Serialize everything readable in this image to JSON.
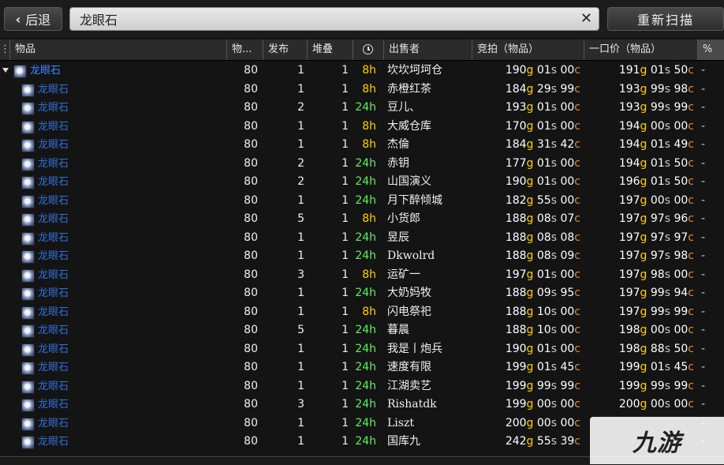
{
  "toolbar": {
    "back_label": "后退",
    "search_value": "龙眼石",
    "rescan_label": "重新扫描"
  },
  "columns": [
    "物品",
    "物...",
    "发布",
    "堆叠",
    "出售者",
    "竞拍（物品）",
    "一口价（物品）",
    "%"
  ],
  "parent": {
    "name": "龙眼石",
    "level": "80",
    "posts": "1",
    "stack": "1",
    "time": "8h",
    "seller": "坎坎坷坷仓",
    "bid": [
      "190",
      "01",
      "00"
    ],
    "buyout": [
      "191",
      "01",
      "50"
    ]
  },
  "rows": [
    {
      "name": "龙眼石",
      "level": "80",
      "posts": "1",
      "stack": "1",
      "time": "8h",
      "seller": "赤橙红茶",
      "bid": [
        "184",
        "29",
        "99"
      ],
      "buyout": [
        "193",
        "99",
        "98"
      ]
    },
    {
      "name": "龙眼石",
      "level": "80",
      "posts": "2",
      "stack": "1",
      "time": "24h",
      "seller": "豆儿、",
      "bid": [
        "193",
        "01",
        "00"
      ],
      "buyout": [
        "193",
        "99",
        "99"
      ]
    },
    {
      "name": "龙眼石",
      "level": "80",
      "posts": "1",
      "stack": "1",
      "time": "8h",
      "seller": "大威仓库",
      "bid": [
        "170",
        "01",
        "00"
      ],
      "buyout": [
        "194",
        "00",
        "00"
      ]
    },
    {
      "name": "龙眼石",
      "level": "80",
      "posts": "1",
      "stack": "1",
      "time": "8h",
      "seller": "杰倫",
      "bid": [
        "184",
        "31",
        "42"
      ],
      "buyout": [
        "194",
        "01",
        "49"
      ]
    },
    {
      "name": "龙眼石",
      "level": "80",
      "posts": "2",
      "stack": "1",
      "time": "24h",
      "seller": "赤钥",
      "bid": [
        "177",
        "01",
        "00"
      ],
      "buyout": [
        "194",
        "01",
        "50"
      ]
    },
    {
      "name": "龙眼石",
      "level": "80",
      "posts": "2",
      "stack": "1",
      "time": "24h",
      "seller": "山国演义",
      "bid": [
        "190",
        "01",
        "00"
      ],
      "buyout": [
        "196",
        "01",
        "50"
      ]
    },
    {
      "name": "龙眼石",
      "level": "80",
      "posts": "1",
      "stack": "1",
      "time": "24h",
      "seller": "月下醉倾城",
      "bid": [
        "182",
        "55",
        "00"
      ],
      "buyout": [
        "197",
        "00",
        "00"
      ]
    },
    {
      "name": "龙眼石",
      "level": "80",
      "posts": "5",
      "stack": "1",
      "time": "8h",
      "seller": "小货郎",
      "bid": [
        "188",
        "08",
        "07"
      ],
      "buyout": [
        "197",
        "97",
        "96"
      ]
    },
    {
      "name": "龙眼石",
      "level": "80",
      "posts": "1",
      "stack": "1",
      "time": "24h",
      "seller": "昱辰",
      "bid": [
        "188",
        "08",
        "08"
      ],
      "buyout": [
        "197",
        "97",
        "97"
      ]
    },
    {
      "name": "龙眼石",
      "level": "80",
      "posts": "1",
      "stack": "1",
      "time": "24h",
      "seller": "Dkwolrd",
      "bid": [
        "188",
        "08",
        "09"
      ],
      "buyout": [
        "197",
        "97",
        "98"
      ]
    },
    {
      "name": "龙眼石",
      "level": "80",
      "posts": "3",
      "stack": "1",
      "time": "8h",
      "seller": "运矿一",
      "bid": [
        "197",
        "01",
        "00"
      ],
      "buyout": [
        "197",
        "98",
        "00"
      ]
    },
    {
      "name": "龙眼石",
      "level": "80",
      "posts": "1",
      "stack": "1",
      "time": "24h",
      "seller": "大奶妈牧",
      "bid": [
        "188",
        "09",
        "95"
      ],
      "buyout": [
        "197",
        "99",
        "94"
      ]
    },
    {
      "name": "龙眼石",
      "level": "80",
      "posts": "1",
      "stack": "1",
      "time": "8h",
      "seller": "闪电祭祀",
      "bid": [
        "188",
        "10",
        "00"
      ],
      "buyout": [
        "197",
        "99",
        "99"
      ]
    },
    {
      "name": "龙眼石",
      "level": "80",
      "posts": "5",
      "stack": "1",
      "time": "24h",
      "seller": "暮晨",
      "bid": [
        "188",
        "10",
        "00"
      ],
      "buyout": [
        "198",
        "00",
        "00"
      ]
    },
    {
      "name": "龙眼石",
      "level": "80",
      "posts": "1",
      "stack": "1",
      "time": "24h",
      "seller": "我是丨炮兵",
      "bid": [
        "190",
        "01",
        "00"
      ],
      "buyout": [
        "198",
        "88",
        "50"
      ]
    },
    {
      "name": "龙眼石",
      "level": "80",
      "posts": "1",
      "stack": "1",
      "time": "24h",
      "seller": "速度有限",
      "bid": [
        "199",
        "01",
        "45"
      ],
      "buyout": [
        "199",
        "01",
        "45"
      ]
    },
    {
      "name": "龙眼石",
      "level": "80",
      "posts": "1",
      "stack": "1",
      "time": "24h",
      "seller": "江湖卖艺",
      "bid": [
        "199",
        "99",
        "99"
      ],
      "buyout": [
        "199",
        "99",
        "99"
      ]
    },
    {
      "name": "龙眼石",
      "level": "80",
      "posts": "3",
      "stack": "1",
      "time": "24h",
      "seller": "Rishatdk",
      "bid": [
        "199",
        "00",
        "00"
      ],
      "buyout": [
        "200",
        "00",
        "00"
      ]
    },
    {
      "name": "龙眼石",
      "level": "80",
      "posts": "1",
      "stack": "1",
      "time": "24h",
      "seller": "Liszt",
      "bid": [
        "200",
        "00",
        "00"
      ],
      "buyout": []
    },
    {
      "name": "龙眼石",
      "level": "80",
      "posts": "1",
      "stack": "1",
      "time": "24h",
      "seller": "国库九",
      "bid": [
        "242",
        "55",
        "39"
      ],
      "buyout": []
    }
  ],
  "currency": {
    "gold": "g",
    "silver": "s",
    "copper": "c"
  },
  "watermark": "九游"
}
